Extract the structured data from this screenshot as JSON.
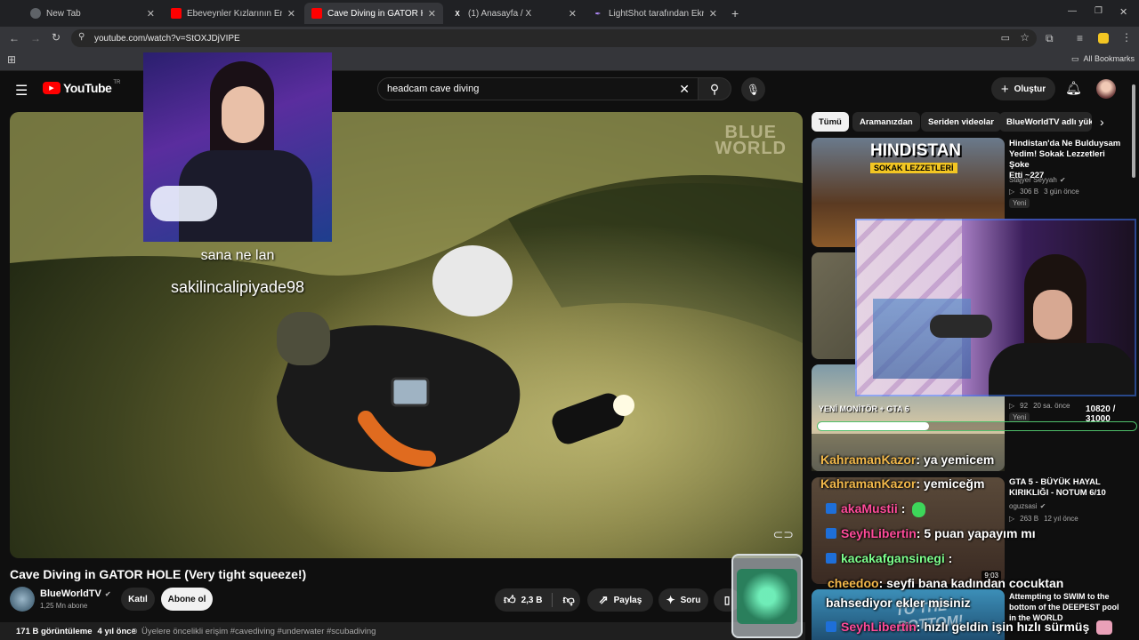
{
  "browser": {
    "tabs": [
      {
        "label": "New Tab",
        "icon": "chrome-icon",
        "active": false
      },
      {
        "label": "Ebeveynler Kızlarının Erkek Arka…",
        "icon": "youtube-icon",
        "active": false
      },
      {
        "label": "Cave Diving in GATOR HOLE",
        "icon": "youtube-icon",
        "active": true
      },
      {
        "label": "(1) Anasayfa / X",
        "icon": "x-icon",
        "active": false
      },
      {
        "label": "LightShot tarafından Ekran Gör…",
        "icon": "lightshot-icon",
        "active": false
      }
    ],
    "url": "youtube.com/watch?v=StOXJDjVIPE",
    "bookmarks_label": "All Bookmarks"
  },
  "youtube": {
    "logo": "YouTube",
    "region": "TR",
    "search_query": "headcam cave diving",
    "create_label": "Oluştur",
    "video_watermark": "BLUE\nWORLD",
    "video_title": "Cave Diving in GATOR HOLE (Very tight squeeze!)",
    "channel_name": "BlueWorldTV",
    "subscribers": "1,25 Mn abone",
    "join_label": "Katıl",
    "subscribe_label": "Abone ol",
    "likes": "2,3 B",
    "share_label": "Paylaş",
    "ask_label": "Soru",
    "views": "171 B görüntüleme",
    "age": "4 yıl önce",
    "desc_line": "Üyelere öncelikli erişim  #cavediving #underwater #scubadiving",
    "chips": [
      "Tümü",
      "Aramanızdan",
      "Seriden videolar",
      "BlueWorldTV adlı yük"
    ],
    "recommended": [
      {
        "title_l1": "Hindistan'da Ne Bulduysam",
        "title_l2": "Yedim! Sokak Lezzetleri Şoke",
        "title_l3": "Etti  ~227",
        "channel": "Stajyer Seyyah",
        "views": "306 B",
        "age": "3 gün önce",
        "badge": "Yeni",
        "thumb_text_1": "HINDISTAN",
        "thumb_text_2": "SOKAK LEZZETLERİ"
      },
      {
        "views": "92",
        "age": "20 sa. önce",
        "badge": "Yeni"
      },
      {
        "title_l1": "GTA 5 - BÜYÜK HAYAL",
        "title_l2": "KIRIKLIĞI - NOTUM 6/10",
        "channel": "oguzsasi",
        "views": "263 B",
        "age": "12 yıl önce"
      },
      {
        "duration": "9:03",
        "title_l1": "Attempting to SWIM to the",
        "title_l2": "bottom of the DEEPEST pool",
        "title_l3": "in the WORLD",
        "thumb_text": "TO THE BOTTOM!"
      }
    ]
  },
  "stream_overlay": {
    "alert_line1": "sana ne lan",
    "alert_line2": "sakilincalipiyade98",
    "goal_label": "YENİ MONİTÖR + GTA 6",
    "goal_progress": "10820 / 31000",
    "goal_fraction": 0.349,
    "chat": [
      {
        "user": "KahramanKazor",
        "msg": ": ya yemicem",
        "badge": false,
        "color": "#f3b94b"
      },
      {
        "user": "KahramanKazor",
        "msg": ": yemiceğm",
        "badge": false,
        "color": "#f3b94b"
      },
      {
        "user": "akaMustii",
        "msg": " :",
        "badge": true,
        "color": "#ff4b9a",
        "emote": "green-blob-emote"
      },
      {
        "user": "SeyhLibertin",
        "msg": ": 5 puan yapayım mı",
        "badge": true,
        "color": "#ff4b9a"
      },
      {
        "user": "kacakafgansinegi",
        "msg": " :",
        "badge": true,
        "color": "#7dff8c"
      },
      {
        "user": "cheedoo",
        "msg": ": seyfi bana kadından cocuktan",
        "badge": false,
        "color": "#f3b94b"
      },
      {
        "user": "",
        "msg": "bahsediyor ekler misiniz",
        "badge": false,
        "color": "#ffffff"
      },
      {
        "user": "SeyhLibertin",
        "msg": ": hızlı geldin işin hızlı sürmüş",
        "badge": true,
        "color": "#ff4b9a"
      }
    ]
  }
}
